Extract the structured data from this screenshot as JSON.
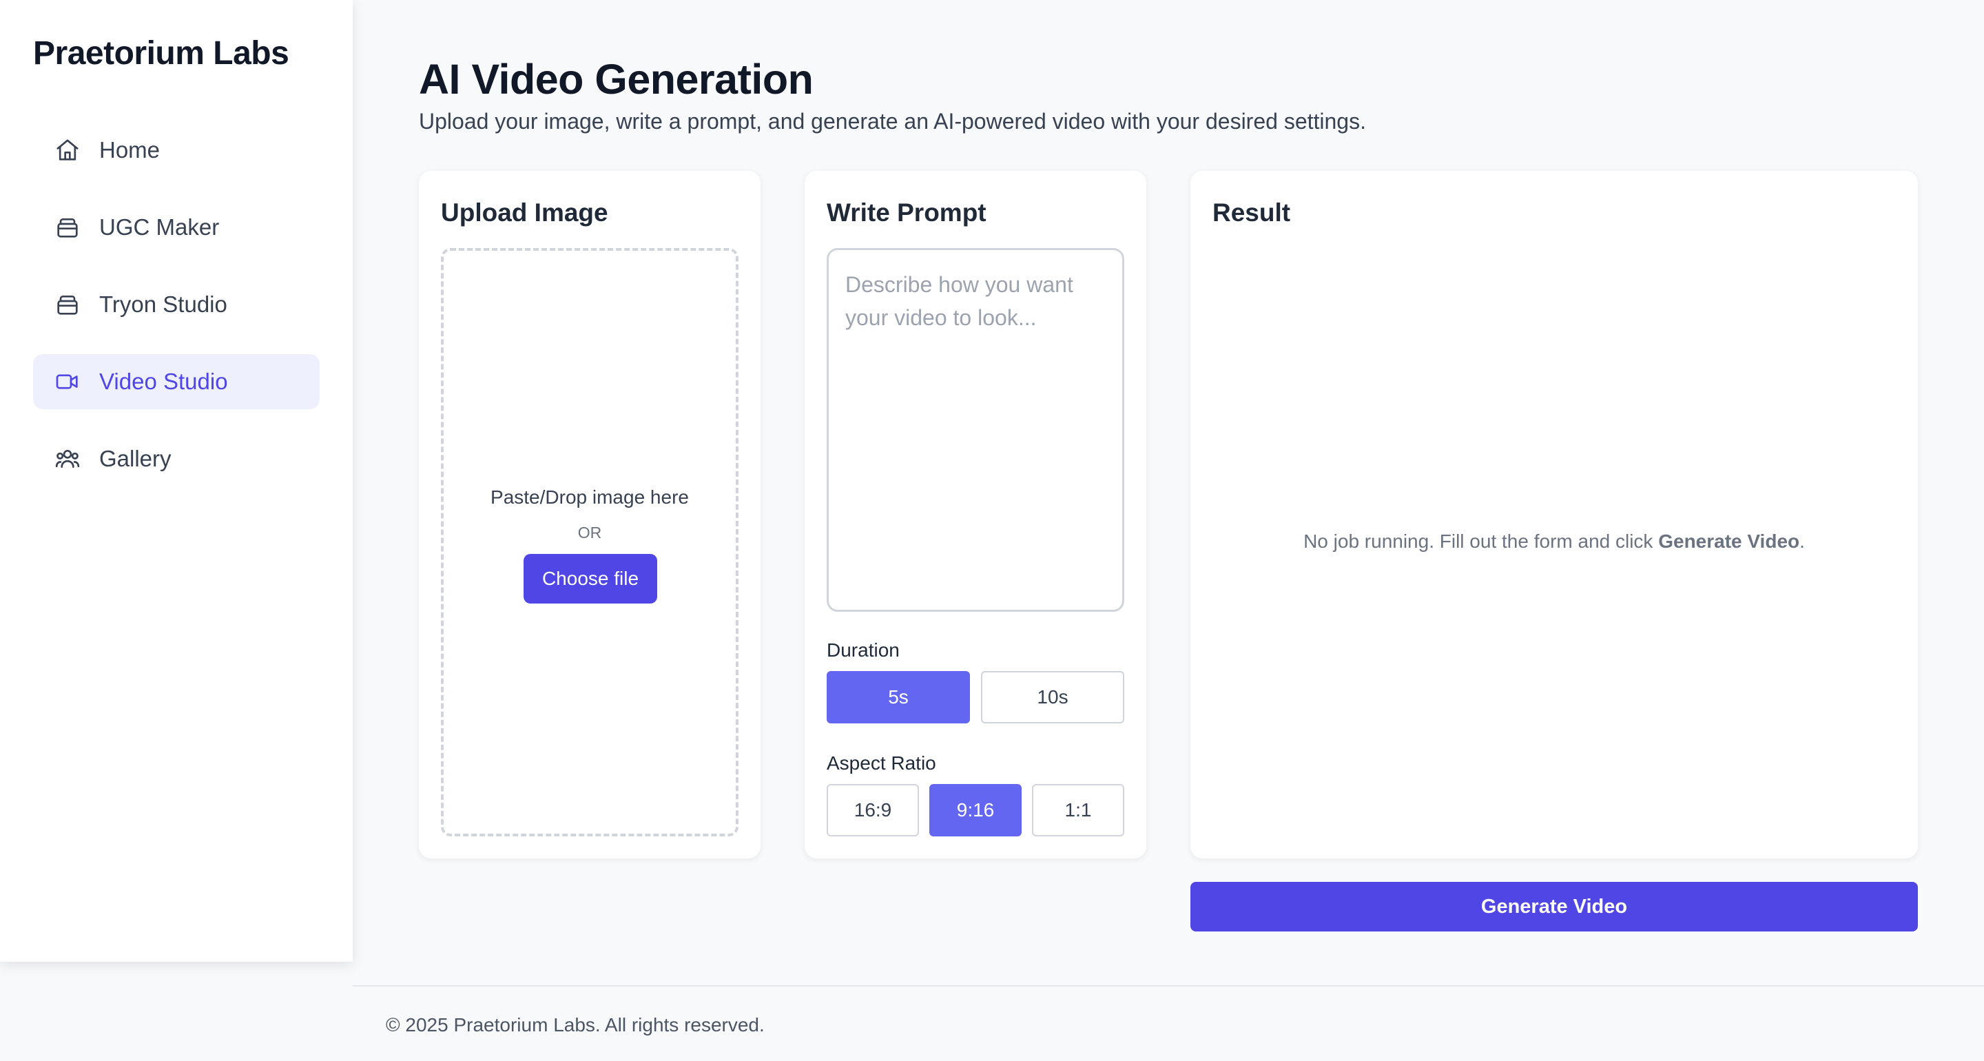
{
  "brand": "Praetorium Labs",
  "sidebar": {
    "items": [
      {
        "label": "Home",
        "icon": "home-icon",
        "active": false
      },
      {
        "label": "UGC Maker",
        "icon": "bag-icon",
        "active": false
      },
      {
        "label": "Tryon Studio",
        "icon": "bag-icon",
        "active": false
      },
      {
        "label": "Video Studio",
        "icon": "video-camera-icon",
        "active": true
      },
      {
        "label": "Gallery",
        "icon": "users-icon",
        "active": false
      }
    ]
  },
  "header": {
    "title": "AI Video Generation",
    "subtitle": "Upload your image, write a prompt, and generate an AI-powered video with your desired settings."
  },
  "upload": {
    "title": "Upload Image",
    "drop_text": "Paste/Drop image here",
    "or_text": "OR",
    "choose_label": "Choose file"
  },
  "prompt": {
    "title": "Write Prompt",
    "value": "",
    "placeholder": "Describe how you want your video to look...",
    "duration_label": "Duration",
    "durations": [
      {
        "label": "5s",
        "selected": true
      },
      {
        "label": "10s",
        "selected": false
      }
    ],
    "aspect_label": "Aspect Ratio",
    "aspects": [
      {
        "label": "16:9",
        "selected": false
      },
      {
        "label": "9:16",
        "selected": true
      },
      {
        "label": "1:1",
        "selected": false
      }
    ]
  },
  "result": {
    "title": "Result",
    "message_prefix": "No job running. Fill out the form and click ",
    "message_bold": "Generate Video",
    "message_suffix": "."
  },
  "generate_label": "Generate Video",
  "footer": "© 2025 Praetorium Labs. All rights reserved.",
  "colors": {
    "accent": "#4f46e5",
    "selected_segment": "#6366f1",
    "active_nav_bg": "#eef0fe"
  }
}
